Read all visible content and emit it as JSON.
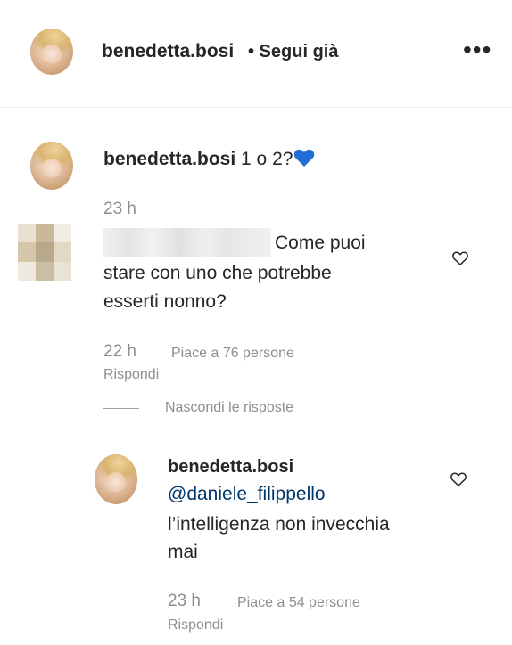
{
  "header": {
    "username": "benedetta.bosi",
    "follow_status": "• Segui già",
    "more_label": "•••"
  },
  "caption": {
    "username": "benedetta.bosi",
    "text": "1 o 2?",
    "emoji": "💙",
    "time": "23 h"
  },
  "comment": {
    "text_line1": "Come puoi",
    "text_line2": "stare con uno che potrebbe",
    "text_line3": "esserti nonno?",
    "time": "22 h",
    "likes": "Piace a 76 persone",
    "reply_label": "Rispondi",
    "hide_replies": "Nascondi le risposte"
  },
  "reply": {
    "username": "benedetta.bosi",
    "mention": "@daniele_filippello",
    "text_line1": "l’intelligenza non invecchia",
    "text_line2": "mai",
    "time": "23 h",
    "likes": "Piace a 54 persone",
    "reply_label": "Rispondi"
  },
  "colors": {
    "heart_blue": "#1f6fd6",
    "mention": "#00376b",
    "muted": "#8e8e8e"
  }
}
